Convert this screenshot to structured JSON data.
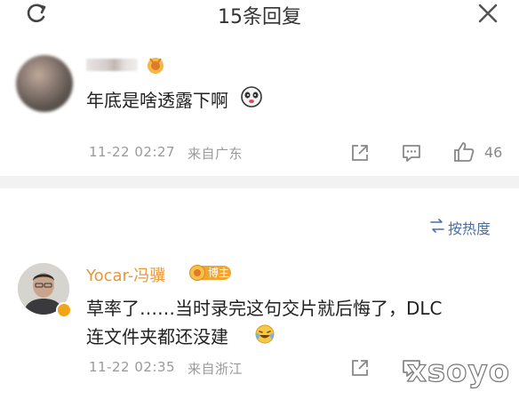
{
  "header": {
    "title": "15条回复",
    "refresh_icon": "refresh-icon",
    "close_icon": "close-icon"
  },
  "reply": {
    "text": "年底是啥透露下啊",
    "emoji": "panda-face-icon",
    "time": "11-22 02:27",
    "location": "来自广东",
    "likes": "46"
  },
  "sort": {
    "label": "按热度"
  },
  "author_reply": {
    "username": "Yocar-冯骥",
    "badge": "博主",
    "line1": "草率了……当时录完这句交片就后悔了，DLC",
    "line2": "连文件夹都还没建",
    "emoji": "laugh-cry-icon",
    "time": "11-22 02:35",
    "location": "来自浙江"
  },
  "watermark": "xsoyo",
  "colors": {
    "accent": "#e8963a",
    "link": "#4a6fa5",
    "meta": "#9a9a9a",
    "divider": "#f2f2f2"
  }
}
